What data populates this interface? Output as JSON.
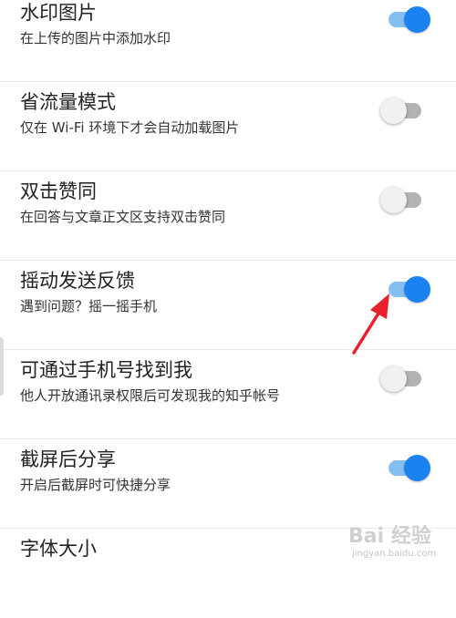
{
  "settings": {
    "items": [
      {
        "title": "水印图片",
        "subtitle": "在上传的图片中添加水印",
        "enabled": true
      },
      {
        "title": "省流量模式",
        "subtitle": "仅在 Wi-Fi 环境下才会自动加载图片",
        "enabled": false
      },
      {
        "title": "双击赞同",
        "subtitle": "在回答与文章正文区支持双击赞同",
        "enabled": false
      },
      {
        "title": "摇动发送反馈",
        "subtitle": "遇到问题？摇一摇手机",
        "enabled": true
      },
      {
        "title": "可通过手机号找到我",
        "subtitle": "他人开放通讯录权限后可发现我的知乎帐号",
        "enabled": false
      },
      {
        "title": "截屏后分享",
        "subtitle": "开启后截屏时可快捷分享",
        "enabled": true
      },
      {
        "title": "字体大小"
      }
    ]
  },
  "watermark": {
    "text": "Bai 经验",
    "url": "jingyan.baidu.com"
  },
  "colors": {
    "toggle_on_knob": "#1b82f0",
    "toggle_on_track": "#85bff2",
    "toggle_off_knob": "#f1f1f1",
    "toggle_off_track": "#b3b3b3",
    "annotation_arrow": "#e8212a"
  }
}
